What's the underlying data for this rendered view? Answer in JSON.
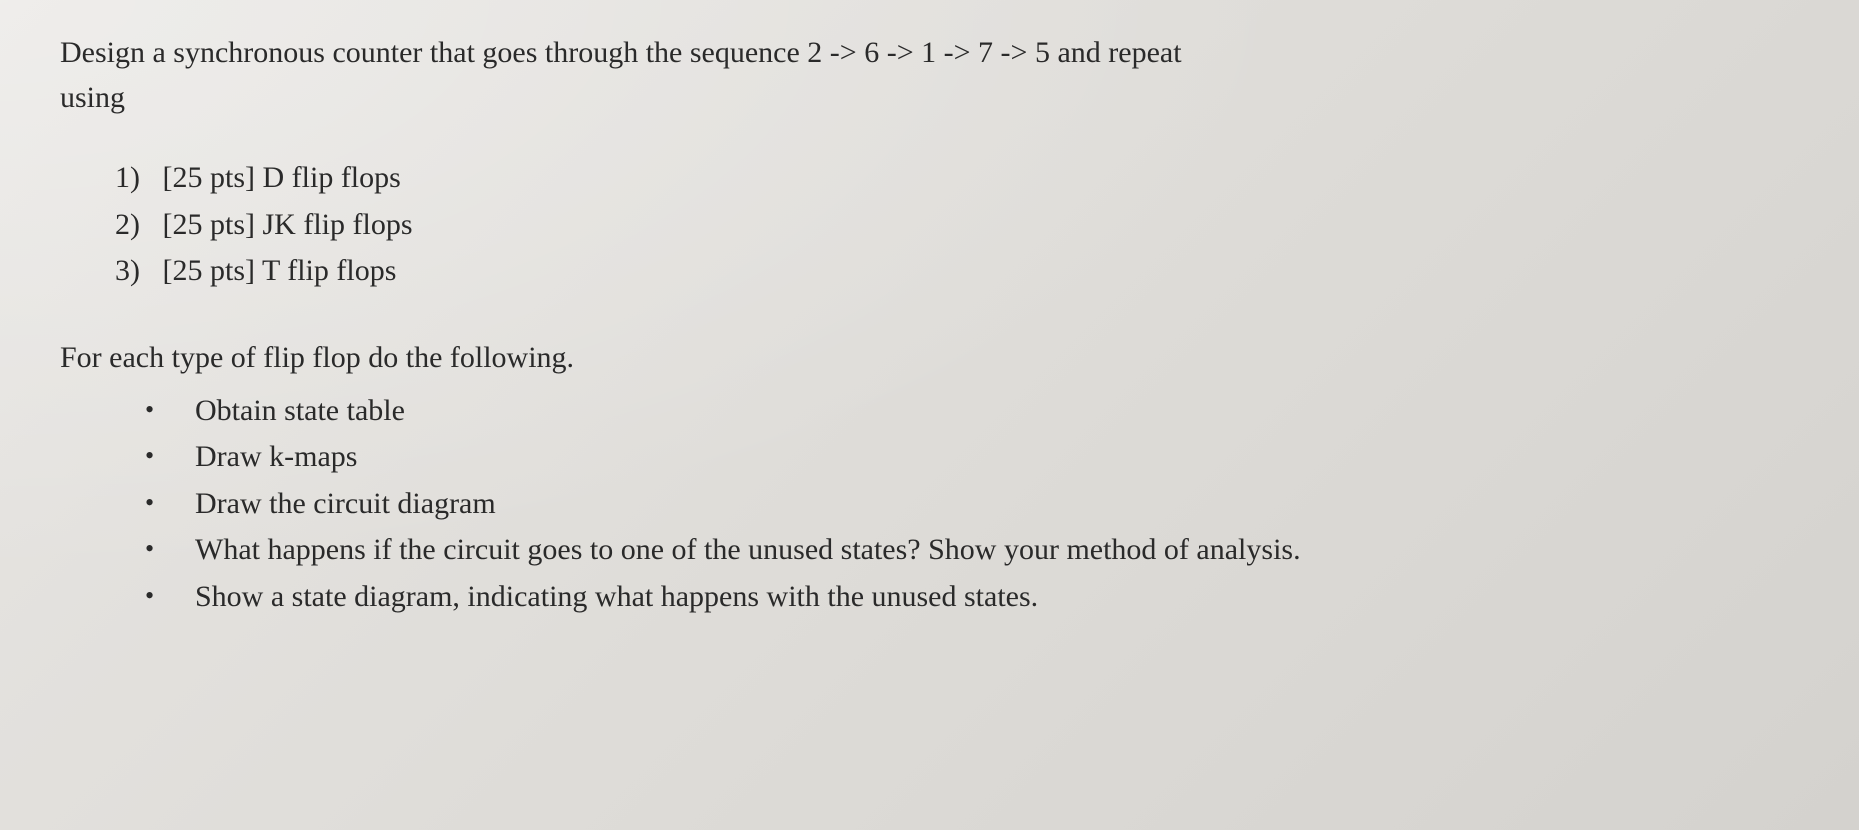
{
  "intro": {
    "line1": "Design a synchronous counter that goes through the sequence 2 -> 6 -> 1 -> 7 -> 5 and repeat",
    "line2": "using"
  },
  "numbered": [
    {
      "num": "1)",
      "text": "[25 pts] D flip flops"
    },
    {
      "num": "2)",
      "text": "[25 pts] JK flip flops"
    },
    {
      "num": "3)",
      "text": "[25 pts] T flip flops"
    }
  ],
  "subheading": "For each type of flip flop do the following.",
  "bullets": [
    "Obtain state table",
    "Draw k-maps",
    "Draw the circuit diagram",
    "What happens if the circuit goes to one of the unused states? Show your method of analysis.",
    "Show a state diagram, indicating what happens with the unused states."
  ]
}
